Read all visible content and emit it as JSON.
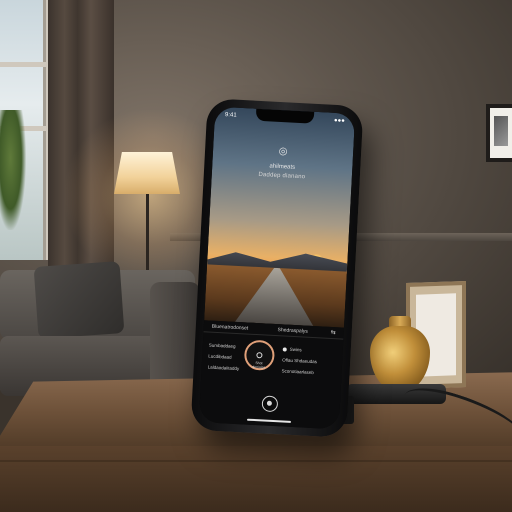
{
  "scene": {
    "description_objects": [
      "living-room",
      "smartphone",
      "desk",
      "lamp",
      "sofa",
      "vase",
      "photo-frame",
      "charger"
    ]
  },
  "phone": {
    "status_left": "9:41",
    "status_right": "●●●",
    "app_icon": "camera-icon",
    "title": "ahilmeats",
    "subtitle": "Daddep dianano",
    "panel": {
      "header_left": "Bluenatrodonset",
      "header_mid": "Shedraspalys",
      "header_right": "⇆",
      "left_items": [
        "Sumbaddaeg",
        "Lucdibdaad",
        "Laldaodaiitaddy"
      ],
      "ring_text": "Shot deniaise",
      "right_items": [
        "Swins",
        "Oflau Shdaeudas",
        "Sconotiaarlaseb"
      ]
    }
  },
  "colors": {
    "ring_accent": "#e0a079",
    "sunset": "#f4a44c"
  }
}
